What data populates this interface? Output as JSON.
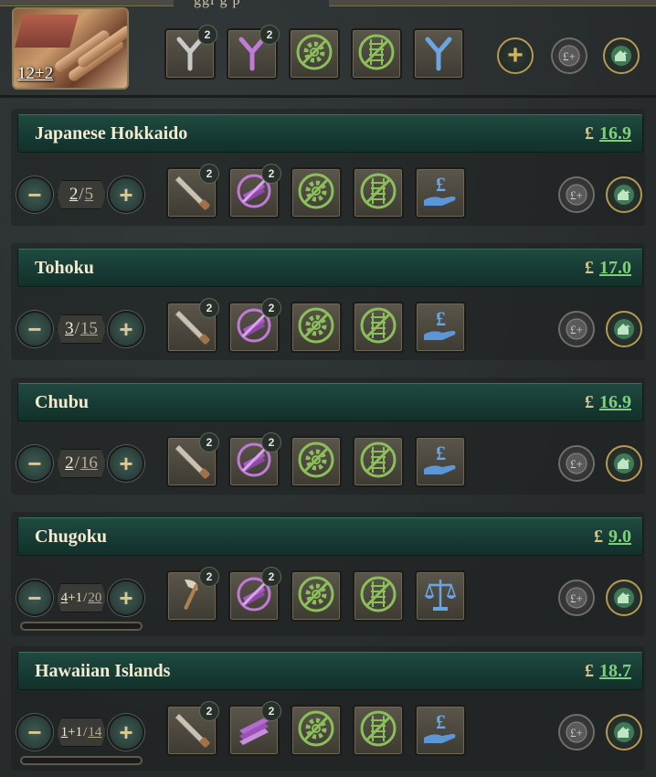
{
  "header": {
    "title_fragment": "ggi  g   p",
    "building_count": "12+2",
    "methods": [
      {
        "name": "branch-icon",
        "badge": "2",
        "color": "#c8c8c8"
      },
      {
        "name": "branch-icon",
        "badge": "2",
        "color": "#c07ad8"
      },
      {
        "name": "gear-crossed-icon",
        "badge": "",
        "color": "#8bbf5a"
      },
      {
        "name": "rail-crossed-icon",
        "badge": "",
        "color": "#8bbf5a"
      },
      {
        "name": "branch-icon",
        "badge": "",
        "color": "#6aa6e6"
      }
    ],
    "actions": {
      "expand": "+",
      "subsidize": "£+",
      "build": "build-plus-icon"
    }
  },
  "states": [
    {
      "name": "Japanese Hokkaido",
      "price_symbol": "£",
      "price": "16.9",
      "level": "2",
      "max": "5",
      "extra": "",
      "methods": [
        {
          "icon": "saw-icon",
          "badge": "2"
        },
        {
          "icon": "planks-crossed-icon",
          "badge": "2"
        },
        {
          "icon": "gear-crossed-icon",
          "badge": ""
        },
        {
          "icon": "rail-crossed-icon",
          "badge": ""
        },
        {
          "icon": "pound-hand-icon",
          "badge": ""
        }
      ],
      "progress": false
    },
    {
      "name": "Tohoku",
      "price_symbol": "£",
      "price": "17.0",
      "level": "3",
      "max": "15",
      "extra": "",
      "methods": [
        {
          "icon": "saw-icon",
          "badge": "2"
        },
        {
          "icon": "planks-crossed-icon",
          "badge": "2"
        },
        {
          "icon": "gear-crossed-icon",
          "badge": ""
        },
        {
          "icon": "rail-crossed-icon",
          "badge": ""
        },
        {
          "icon": "pound-hand-icon",
          "badge": ""
        }
      ],
      "progress": false
    },
    {
      "name": "Chubu",
      "price_symbol": "£",
      "price": "16.9",
      "level": "2",
      "max": "16",
      "extra": "",
      "methods": [
        {
          "icon": "saw-icon",
          "badge": "2"
        },
        {
          "icon": "planks-crossed-icon",
          "badge": "2"
        },
        {
          "icon": "gear-crossed-icon",
          "badge": ""
        },
        {
          "icon": "rail-crossed-icon",
          "badge": ""
        },
        {
          "icon": "pound-hand-icon",
          "badge": ""
        }
      ],
      "progress": false
    },
    {
      "name": "Chugoku",
      "price_symbol": "£",
      "price": "9.0",
      "level": "4",
      "max": "20",
      "extra": "+1",
      "methods": [
        {
          "icon": "axe-icon",
          "badge": "2"
        },
        {
          "icon": "planks-crossed-icon",
          "badge": "2"
        },
        {
          "icon": "gear-crossed-icon",
          "badge": ""
        },
        {
          "icon": "rail-crossed-icon",
          "badge": ""
        },
        {
          "icon": "scales-icon",
          "badge": ""
        }
      ],
      "progress": true
    },
    {
      "name": "Hawaiian Islands",
      "price_symbol": "£",
      "price": "18.7",
      "level": "1",
      "max": "14",
      "extra": "+1",
      "methods": [
        {
          "icon": "saw-icon",
          "badge": "2"
        },
        {
          "icon": "planks-icon",
          "badge": "2"
        },
        {
          "icon": "gear-crossed-icon",
          "badge": ""
        },
        {
          "icon": "rail-crossed-icon",
          "badge": ""
        },
        {
          "icon": "pound-hand-icon",
          "badge": ""
        }
      ],
      "progress": true
    }
  ],
  "labels": {
    "minus": "−",
    "plus": "+",
    "slash": "/"
  }
}
